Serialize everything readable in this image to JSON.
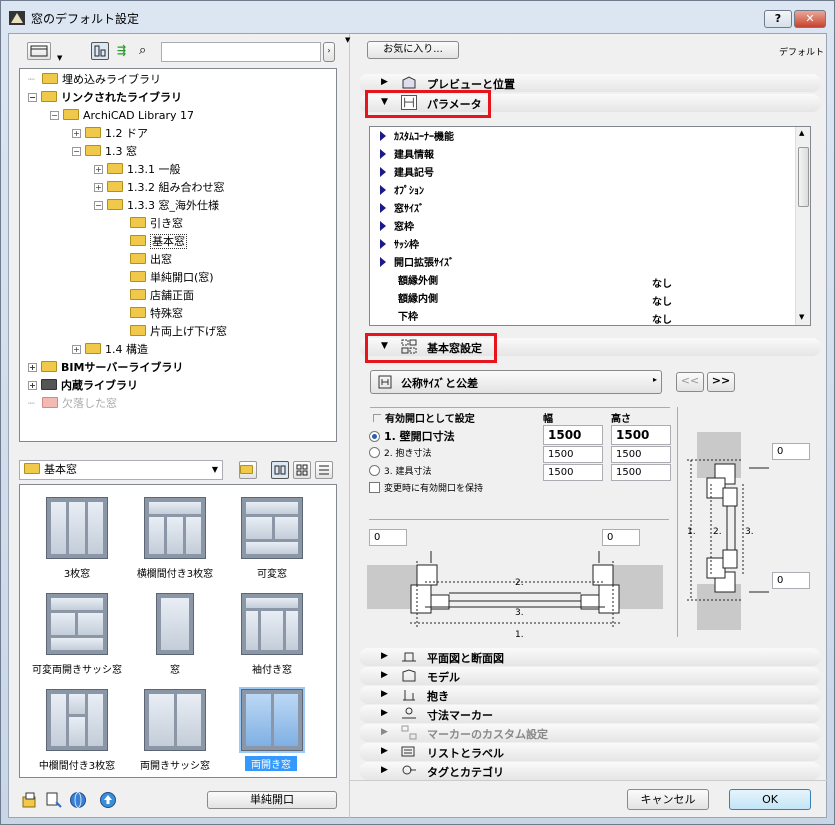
{
  "window": {
    "title": "窓のデフォルト設定",
    "help_label": "?",
    "close_label": "✕"
  },
  "library": {
    "search_placeholder": "",
    "tree": [
      {
        "label": "埋め込みライブラリ",
        "bold": false
      },
      {
        "label": "リンクされたライブラリ",
        "bold": true
      },
      {
        "label": "ArchiCAD Library 17",
        "bold": false
      },
      {
        "label": "1.2 ドア",
        "bold": false
      },
      {
        "label": "1.3 窓",
        "bold": false
      },
      {
        "label": "1.3.1 一般",
        "bold": false
      },
      {
        "label": "1.3.2 組み合わせ窓",
        "bold": false
      },
      {
        "label": "1.3.3 窓_海外仕様",
        "bold": false
      },
      {
        "label": "引き窓",
        "bold": false
      },
      {
        "label": "基本窓",
        "bold": false
      },
      {
        "label": "出窓",
        "bold": false
      },
      {
        "label": "単純開口(窓)",
        "bold": false
      },
      {
        "label": "店舗正面",
        "bold": false
      },
      {
        "label": "特殊窓",
        "bold": false
      },
      {
        "label": "片両上げ下げ窓",
        "bold": false
      },
      {
        "label": "1.4 構造",
        "bold": false
      },
      {
        "label": "BIMサーバーライブラリ",
        "bold": true
      },
      {
        "label": "内蔵ライブラリ",
        "bold": true
      },
      {
        "label": "欠落した窓",
        "bold": false
      }
    ],
    "folder_select": "基本窓",
    "thumbnails": [
      {
        "label": "3枚窓"
      },
      {
        "label": "横欄間付き3枚窓"
      },
      {
        "label": "可変窓"
      },
      {
        "label": "可変両開きサッシ窓"
      },
      {
        "label": "窓"
      },
      {
        "label": "袖付き窓"
      },
      {
        "label": "中欄間付き3枚窓"
      },
      {
        "label": "両開きサッシ窓"
      },
      {
        "label": "両開き窓"
      }
    ],
    "bottom_button": "単純開口"
  },
  "right": {
    "favorites_button": "お気に入り...",
    "default_label": "デフォルト",
    "sections_top": [
      {
        "label": "プレビューと位置"
      },
      {
        "label": "パラメータ"
      }
    ],
    "params": [
      {
        "label": "ｶｽﾀﾑｺｰﾅｰ機能",
        "value": "",
        "expandable": true
      },
      {
        "label": "建具情報",
        "value": "",
        "expandable": true
      },
      {
        "label": "建具記号",
        "value": "",
        "expandable": true
      },
      {
        "label": "ｵﾌﾟｼｮﾝ",
        "value": "",
        "expandable": true
      },
      {
        "label": "窓ｻｲｽﾞ",
        "value": "",
        "expandable": true
      },
      {
        "label": "窓枠",
        "value": "",
        "expandable": true
      },
      {
        "label": "ｻｯｼ枠",
        "value": "",
        "expandable": true
      },
      {
        "label": "開口拡張ｻｲｽﾞ",
        "value": "",
        "expandable": true
      },
      {
        "label": "額縁外側",
        "value": "なし",
        "expandable": false
      },
      {
        "label": "額縁内側",
        "value": "なし",
        "expandable": false
      },
      {
        "label": "下枠",
        "value": "なし",
        "expandable": false
      }
    ],
    "basic_section": "基本窓設定",
    "dropdown": "公称ｻｲｽﾞと公差",
    "prev_btn": "<<",
    "next_btn": ">>",
    "effective_label": "有効開口として設定",
    "col_width": "幅",
    "col_height": "高さ",
    "rows": [
      {
        "label": "1. 壁開口寸法",
        "w": "1500",
        "h": "1500"
      },
      {
        "label": "2. 抱き寸法",
        "w": "1500",
        "h": "1500"
      },
      {
        "label": "3. 建具寸法",
        "w": "1500",
        "h": "1500"
      }
    ],
    "keep_label": "変更時に有効開口を保持",
    "diag_values": {
      "left_field": "0",
      "right_field": "0",
      "vert_top": "0",
      "vert_bottom": "0"
    },
    "diag_labels": {
      "one": "1.",
      "two": "2.",
      "three": "3."
    },
    "sections_bottom": [
      {
        "label": "平面図と断面図",
        "dim": false
      },
      {
        "label": "モデル",
        "dim": false
      },
      {
        "label": "抱き",
        "dim": false
      },
      {
        "label": "寸法マーカー",
        "dim": false
      },
      {
        "label": "マーカーのカスタム設定",
        "dim": true
      },
      {
        "label": "リストとラベル",
        "dim": false
      },
      {
        "label": "タグとカテゴリ",
        "dim": false
      }
    ],
    "cancel": "キャンセル",
    "ok": "OK"
  },
  "colors": {
    "highlight_red": "#e8141b",
    "selection_blue": "#3399ff",
    "folder_yellow": "#f0c84a"
  }
}
